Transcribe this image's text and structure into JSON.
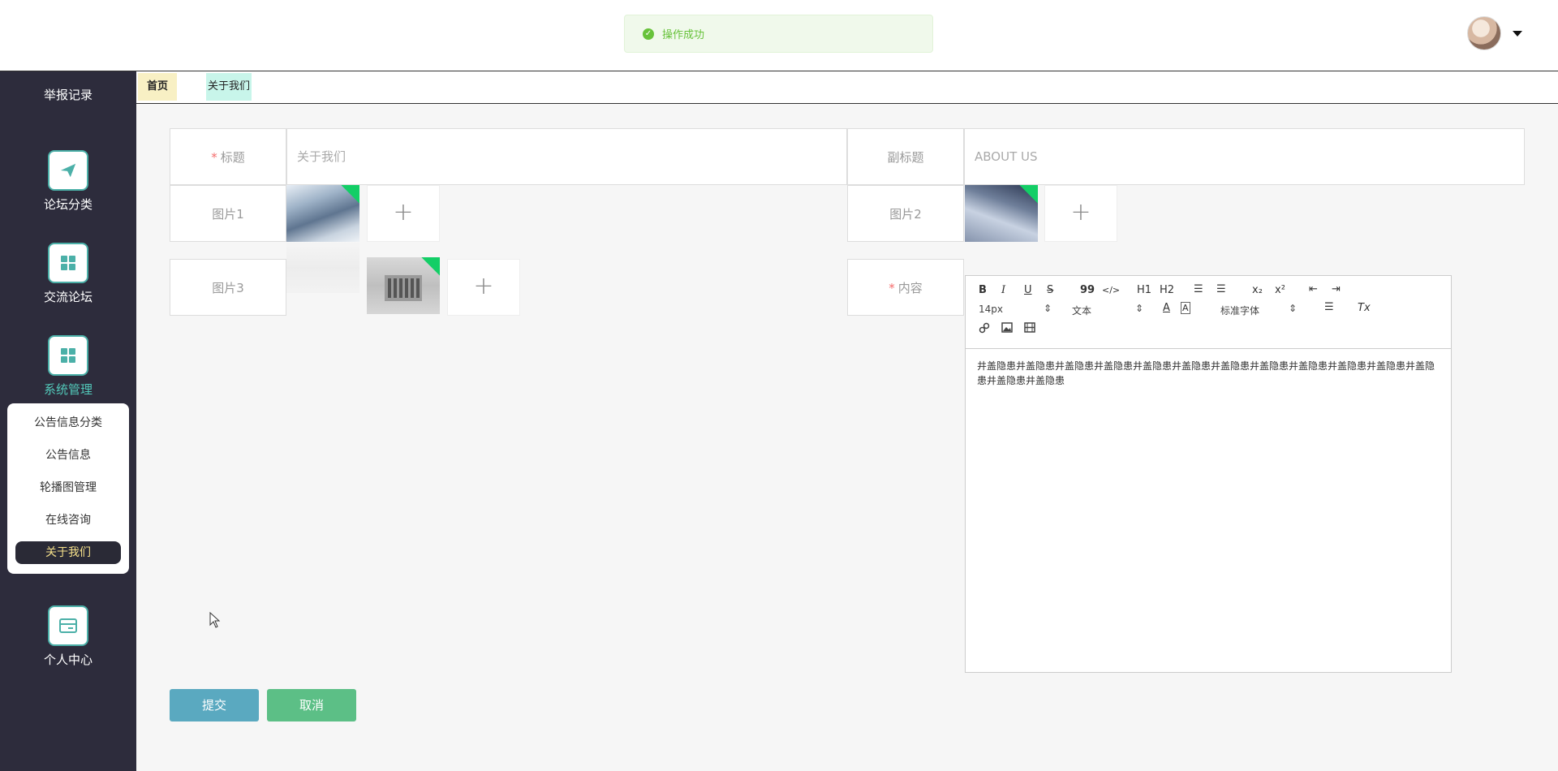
{
  "toast": {
    "message": "操作成功"
  },
  "sidebar": {
    "items": [
      {
        "label": "举报记录"
      },
      {
        "label": "论坛分类"
      },
      {
        "label": "交流论坛"
      },
      {
        "label": "系统管理"
      },
      {
        "label": "个人中心"
      }
    ],
    "submenu": [
      "公告信息分类",
      "公告信息",
      "轮播图管理",
      "在线咨询",
      "关于我们"
    ]
  },
  "tabs": [
    {
      "label": "首页"
    },
    {
      "label": "关于我们"
    }
  ],
  "form": {
    "title_label": "标题",
    "title_value": "关于我们",
    "subtitle_label": "副标题",
    "subtitle_value": "ABOUT US",
    "image1_label": "图片1",
    "image2_label": "图片2",
    "image3_label": "图片3",
    "content_label": "内容",
    "required_mark": "*",
    "upload_plus": "+"
  },
  "editor": {
    "toolbar": {
      "bold": "B",
      "italic": "I",
      "underline": "U",
      "strike": "S",
      "quote": "99",
      "code": "</>",
      "h1": "H1",
      "h2": "H2",
      "sub": "x₂",
      "sup": "x²",
      "clear": "Tx",
      "font_size": "14px",
      "text_style": "文本",
      "font_family": "标准字体",
      "font_color": "A"
    },
    "content": "井盖隐患井盖隐患井盖隐患井盖隐患井盖隐患井盖隐患井盖隐患井盖隐患井盖隐患井盖隐患井盖隐患井盖隐患井盖隐患井盖隐患"
  },
  "buttons": {
    "submit": "提交",
    "cancel": "取消"
  },
  "colors": {
    "sidebar_bg": "#2d2c3c",
    "accent": "#4bb0a8",
    "success": "#67c23a",
    "submit": "#5aa9c0",
    "cancel": "#5cbf86"
  }
}
